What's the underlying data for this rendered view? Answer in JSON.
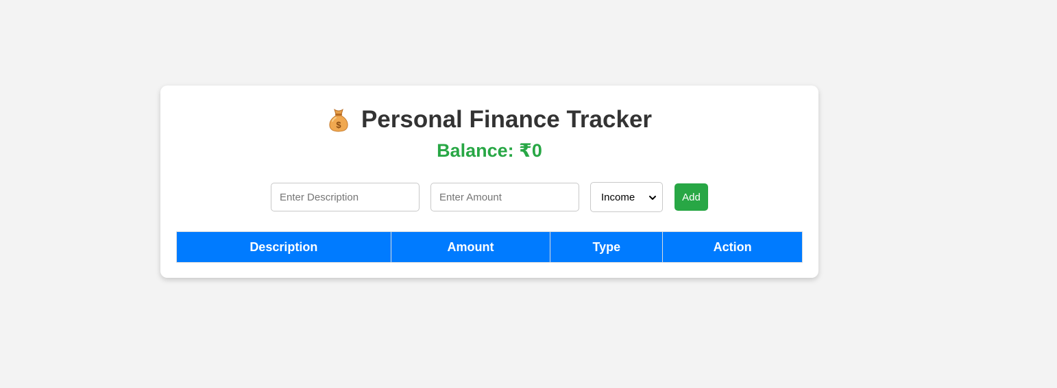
{
  "app": {
    "title": "Personal Finance Tracker",
    "title_icon": "money-bag-icon",
    "balance_text": "Balance: ₹0"
  },
  "form": {
    "description_placeholder": "Enter Description",
    "amount_placeholder": "Enter Amount",
    "type_selected": "Income",
    "add_label": "Add"
  },
  "table": {
    "columns": [
      "Description",
      "Amount",
      "Type",
      "Action"
    ],
    "rows": []
  },
  "colors": {
    "page_background": "#f3f3f3",
    "balance_green": "#28a745",
    "add_button_green": "#28a745",
    "table_header_blue": "#007bff",
    "title_text": "#333333"
  }
}
